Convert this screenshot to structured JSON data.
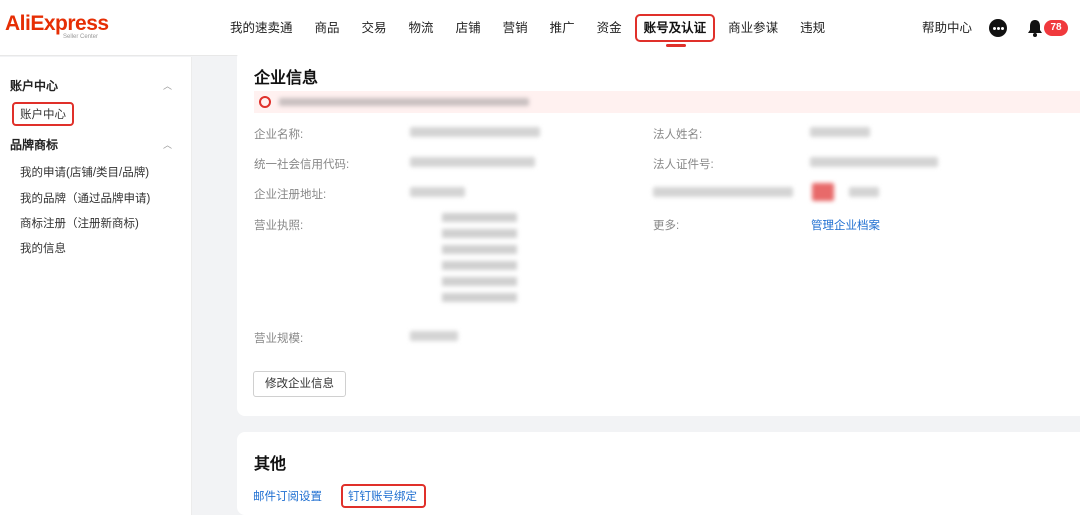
{
  "logo": {
    "brand": "AliExpress",
    "sub": "Seller Center"
  },
  "nav": {
    "items": [
      "我的速卖通",
      "商品",
      "交易",
      "物流",
      "店铺",
      "营销",
      "推广",
      "资金",
      "账号及认证",
      "商业参谋",
      "违规"
    ],
    "active_index": 8,
    "help": "帮助中心",
    "notification_count": "78"
  },
  "sidebar": {
    "groups": [
      {
        "title": "账户中心",
        "items": [
          "账户中心"
        ]
      },
      {
        "title": "品牌商标",
        "items": [
          "我的申请(店铺/类目/品牌)",
          "我的品牌（通过品牌申请)",
          "商标注册（注册新商标)",
          "我的信息"
        ]
      }
    ]
  },
  "company": {
    "title": "企业信息",
    "fields_left": [
      "企业名称:",
      "统一社会信用代码:",
      "企业注册地址:",
      "营业执照:",
      "营业规模:"
    ],
    "fields_right": [
      "法人姓名:",
      "法人证件号:",
      "更多:"
    ],
    "more_link": "管理企业档案",
    "edit_button": "修改企业信息"
  },
  "other": {
    "title": "其他",
    "links": [
      "邮件订阅设置",
      "钉钉账号绑定"
    ]
  },
  "colors": {
    "accent": "#e0302a",
    "brand": "#e62e04",
    "link": "#1f6fd1"
  }
}
